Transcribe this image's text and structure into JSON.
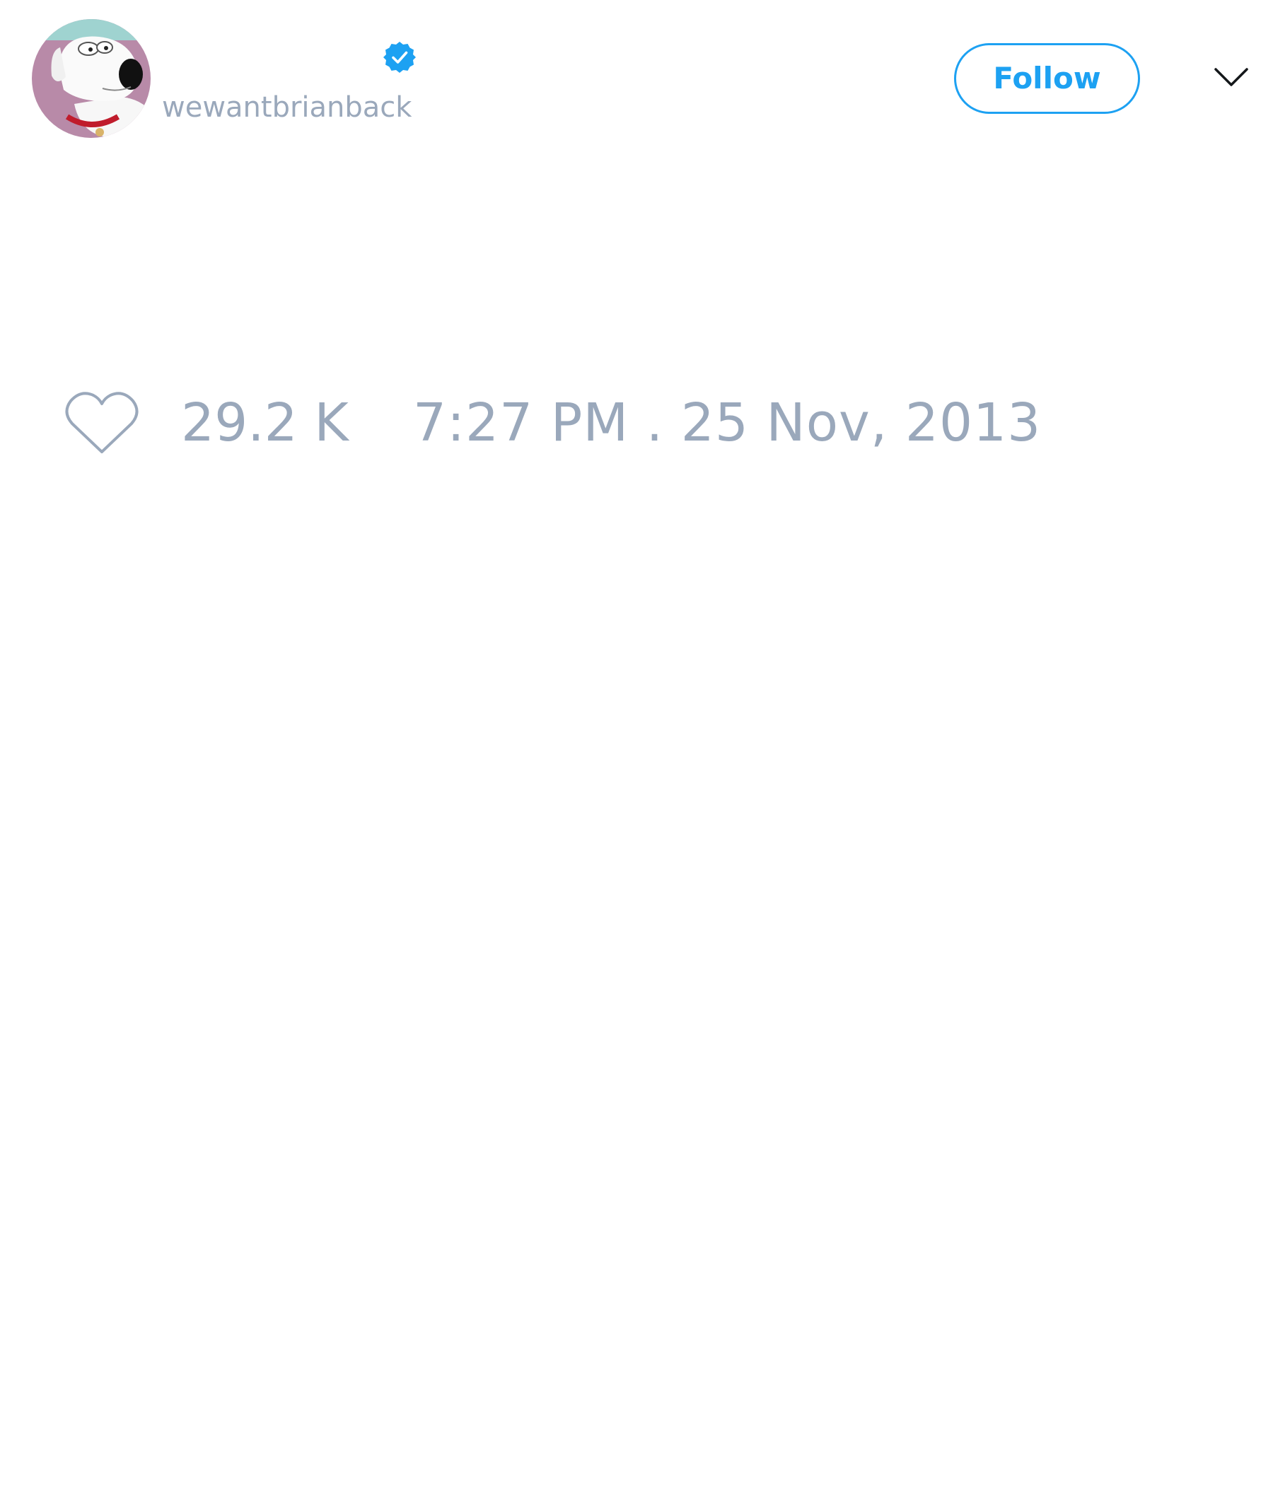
{
  "header": {
    "display_name": "",
    "username": "wewantbrianback",
    "follow_label": "Follow",
    "avatar_icon": "brian-griffin-dog-avatar",
    "verified_icon": "verified-badge-icon",
    "menu_icon": "chevron-down-icon"
  },
  "footer": {
    "like_icon": "heart-outline-icon",
    "like_count": "29.2 K",
    "timestamp": "7:27 PM . 25 Nov, 2013"
  },
  "colors": {
    "accent": "#1da1f2",
    "muted_text": "#9aa8bb",
    "background": "#ffffff"
  }
}
